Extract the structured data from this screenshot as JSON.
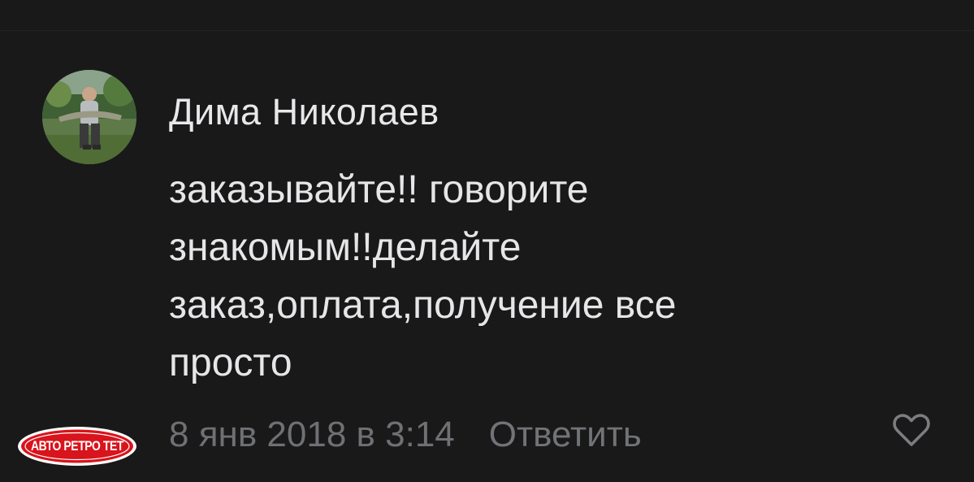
{
  "comment": {
    "author": "Дима Николаев",
    "avatar_icon": "user-photo-avatar",
    "text_lines": [
      "заказывайте!! говорите",
      "знакомым!!делайте",
      "заказ,оплата,получение все",
      "просто"
    ],
    "timestamp": "8 янв 2018 в 3:14",
    "reply_label": "Ответить",
    "like_icon": "heart-outline-icon"
  },
  "watermark": {
    "text": "АВТО РЕТРО ТЕТ",
    "color": "#d8141c"
  },
  "colors": {
    "background": "#19191a",
    "primary_text": "#e6e6e8",
    "secondary_text": "#6f7073"
  }
}
